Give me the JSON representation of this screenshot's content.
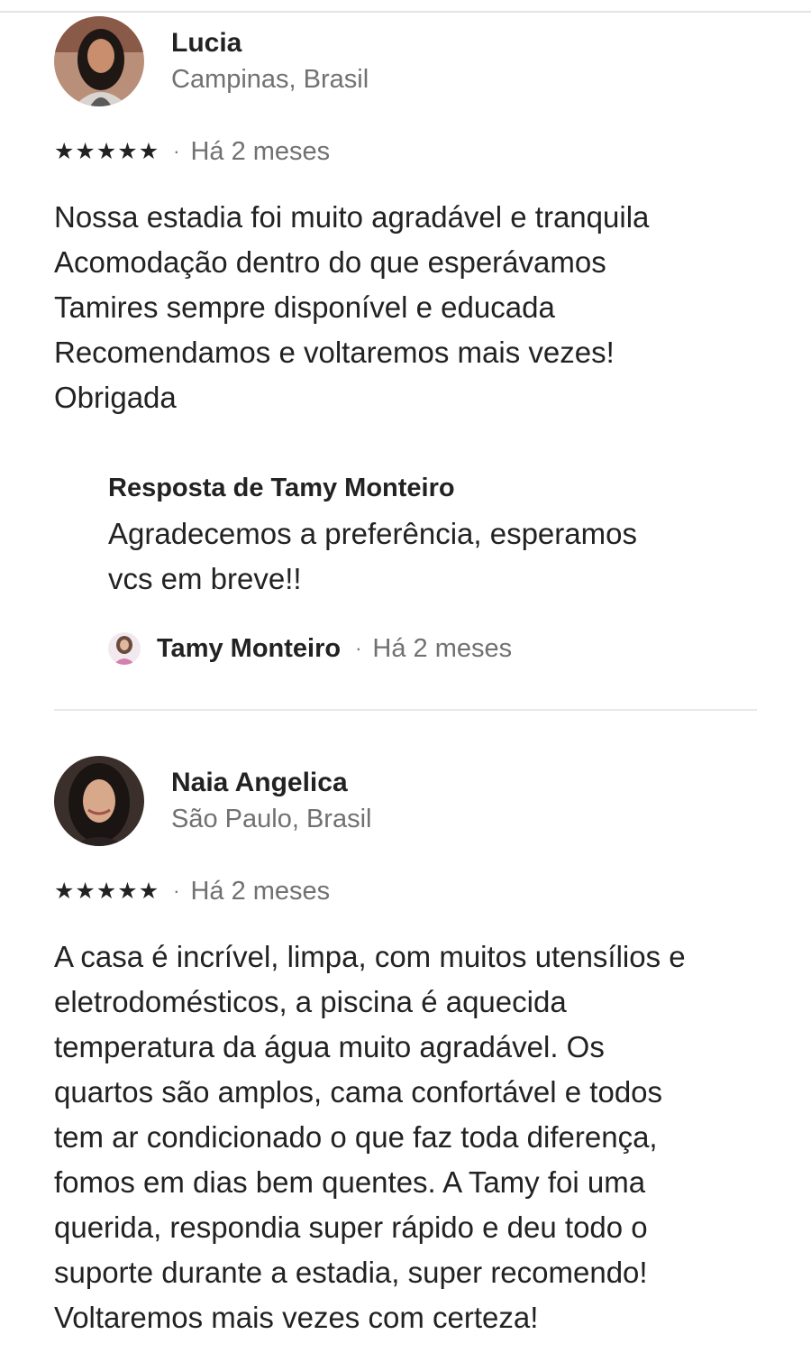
{
  "reviews": [
    {
      "name": "Lucia",
      "location": "Campinas, Brasil",
      "rating": 5,
      "date": "Há 2 meses",
      "text_lines": [
        "Nossa estadia foi muito agradável e tranquila",
        "Acomodação dentro do que esperávamos",
        "Tamires sempre disponível e educada",
        "Recomendamos e voltaremos mais vezes!",
        "Obrigada"
      ],
      "response": {
        "title": "Resposta de Tamy Monteiro",
        "text_lines": [
          "Agradecemos a preferência, esperamos",
          "vcs em breve!!"
        ],
        "host_name": "Tamy Monteiro",
        "date": "Há 2 meses"
      }
    },
    {
      "name": "Naia Angelica",
      "location": "São Paulo, Brasil",
      "rating": 5,
      "date": "Há 2 meses",
      "text_lines": [
        "A casa é incrível, limpa, com muitos utensílios e",
        "eletrodomésticos, a piscina é aquecida",
        "temperatura da água muito agradável. Os",
        "quartos são amplos, cama confortável e todos",
        "tem ar condicionado o que faz toda diferença,",
        "fomos em dias bem quentes. A Tamy foi uma",
        "querida, respondia super rápido e deu todo o",
        "suporte durante a estadia, super recomendo!",
        "Voltaremos mais vezes com certeza!"
      ]
    }
  ],
  "separator": "·",
  "icons": {
    "star": "star-icon"
  }
}
